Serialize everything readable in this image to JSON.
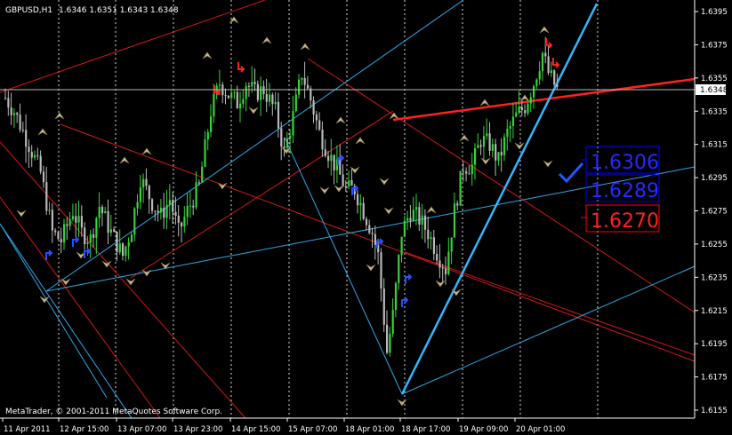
{
  "header": {
    "symbol": "GBPUSD,H1",
    "ohlc": "1.6346 1.6351 1.6343 1.6348"
  },
  "footer": {
    "copyright": "MetaTrader, © 2001-2011 MetaQuotes Software Corp."
  },
  "current_price": "1.6348",
  "levels": [
    {
      "label": "1.6306",
      "color": "#0000ff"
    },
    {
      "label": "1.6289",
      "color": "#0000ff"
    },
    {
      "label": "1.6270",
      "color": "#ff0000"
    }
  ],
  "colors": {
    "background": "#000000",
    "grid": "#d8d8d8",
    "bull": "#36d33a",
    "bear": "#b9b9b9",
    "channel_red": "#d51818",
    "channel_blue": "#2fa8e6",
    "marker": "#c8b98a"
  },
  "chart_data": {
    "type": "candlestick",
    "title": "GBPUSD,H1",
    "xlabel": "",
    "ylabel": "",
    "ylim": [
      1.6145,
      1.6398
    ],
    "y_ticks": [
      "1.6395",
      "1.6375",
      "1.6355",
      "1.6335",
      "1.6315",
      "1.6295",
      "1.6275",
      "1.6255",
      "1.6235",
      "1.6215",
      "1.6195",
      "1.6175",
      "1.6155"
    ],
    "x_ticks": [
      "11 Apr 2011",
      "12 Apr 15:00",
      "13 Apr 07:00",
      "13 Apr 23:00",
      "14 Apr 15:00",
      "15 Apr 07:00",
      "18 Apr 01:00",
      "18 Apr 17:00",
      "19 Apr 09:00",
      "20 Apr 01:00"
    ],
    "grid": true,
    "close_path": [
      [
        0,
        1.6343
      ],
      [
        3,
        1.6335
      ],
      [
        8,
        1.6315
      ],
      [
        12,
        1.6298
      ],
      [
        16,
        1.6262
      ],
      [
        19,
        1.6257
      ],
      [
        23,
        1.6275
      ],
      [
        26,
        1.6262
      ],
      [
        29,
        1.6258
      ],
      [
        32,
        1.6278
      ],
      [
        36,
        1.6262
      ],
      [
        40,
        1.6248
      ],
      [
        43,
        1.6265
      ],
      [
        46,
        1.6295
      ],
      [
        50,
        1.628
      ],
      [
        53,
        1.6272
      ],
      [
        56,
        1.6282
      ],
      [
        59,
        1.6262
      ],
      [
        62,
        1.6275
      ],
      [
        66,
        1.629
      ],
      [
        70,
        1.6335
      ],
      [
        73,
        1.6352
      ],
      [
        76,
        1.6345
      ],
      [
        79,
        1.634
      ],
      [
        82,
        1.6352
      ],
      [
        85,
        1.6346
      ],
      [
        88,
        1.6348
      ],
      [
        92,
        1.6335
      ],
      [
        95,
        1.631
      ],
      [
        98,
        1.6332
      ],
      [
        101,
        1.6358
      ],
      [
        104,
        1.6342
      ],
      [
        107,
        1.6322
      ],
      [
        110,
        1.631
      ],
      [
        113,
        1.63
      ],
      [
        116,
        1.6288
      ],
      [
        119,
        1.6288
      ],
      [
        122,
        1.6275
      ],
      [
        125,
        1.6262
      ],
      [
        127,
        1.6248
      ],
      [
        130,
        1.619
      ],
      [
        132,
        1.6212
      ],
      [
        135,
        1.6262
      ],
      [
        138,
        1.6275
      ],
      [
        141,
        1.627
      ],
      [
        144,
        1.6262
      ],
      [
        147,
        1.625
      ],
      [
        150,
        1.624
      ],
      [
        153,
        1.6275
      ],
      [
        156,
        1.6302
      ],
      [
        159,
        1.6302
      ],
      [
        162,
        1.6318
      ],
      [
        165,
        1.6315
      ],
      [
        168,
        1.6305
      ],
      [
        171,
        1.6322
      ],
      [
        174,
        1.6332
      ],
      [
        177,
        1.6338
      ],
      [
        180,
        1.6352
      ],
      [
        183,
        1.637
      ],
      [
        185,
        1.6358
      ],
      [
        188,
        1.6348
      ]
    ],
    "channels": {
      "red_lines": [
        {
          "from": [
            1.633,
            "17 Apr"
          ],
          "to": [
            1.6352,
            "20 Apr"
          ]
        }
      ],
      "blue_lines": [
        {
          "from": [
            1.6163,
            "18 Apr"
          ],
          "to": [
            1.6398,
            "20 Apr"
          ]
        }
      ]
    }
  }
}
